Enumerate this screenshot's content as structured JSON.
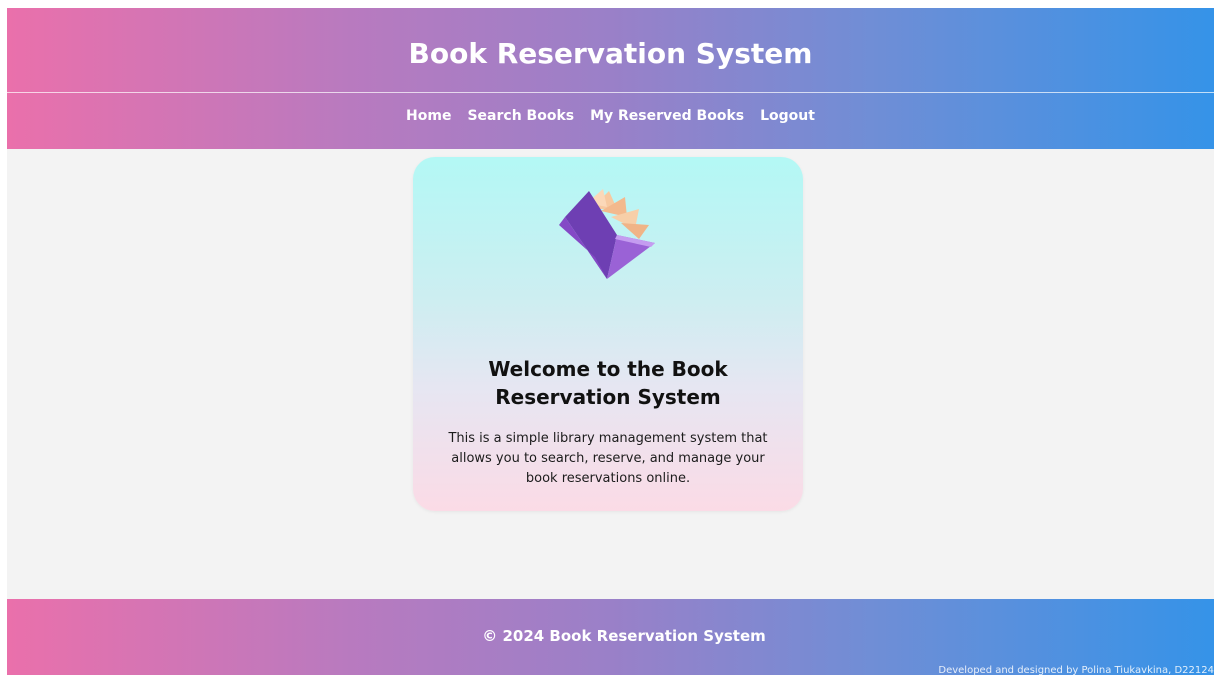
{
  "header": {
    "title": "Book Reservation System"
  },
  "nav": {
    "items": [
      {
        "label": "Home"
      },
      {
        "label": "Search Books"
      },
      {
        "label": "My Reserved Books"
      },
      {
        "label": "Logout"
      }
    ]
  },
  "main": {
    "card": {
      "icon": "open-book-icon",
      "title": "Welcome to the Book Reservation System",
      "text": "This is a simple library management system that allows you to search, reserve, and manage your book reservations online."
    }
  },
  "footer": {
    "copyright": "© 2024 Book Reservation System",
    "credit": "Developed and designed by Polina Tiukavkina, D22124"
  },
  "colors": {
    "gradient_start": "#ea70ab",
    "gradient_end": "#3593e8",
    "card_top": "#b3f8f5",
    "card_bottom": "#fbdbe6",
    "background": "#f3f3f3"
  }
}
